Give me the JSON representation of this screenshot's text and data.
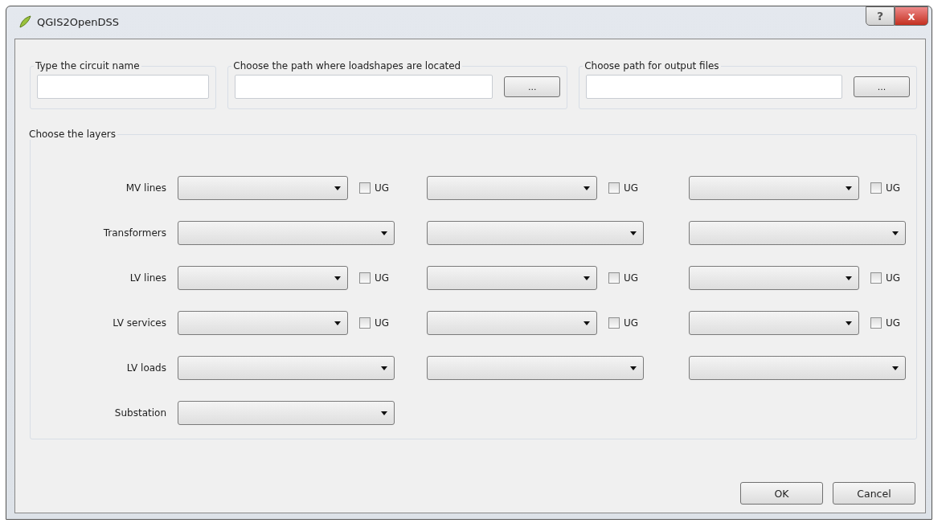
{
  "window": {
    "title": "QGIS2OpenDSS",
    "help_button": "?",
    "close_button": "x"
  },
  "path_groups": [
    {
      "title": "Type the circuit name"
    },
    {
      "title": "Choose the path where loadshapes are located",
      "browse": "..."
    },
    {
      "title": "Choose path for output files",
      "browse": "..."
    }
  ],
  "layers": {
    "title": "Choose the layers",
    "rows": [
      {
        "label": "MV lines",
        "cells": [
          {
            "kind": "combo_ug",
            "ug": "UG",
            "checked": false
          },
          {
            "kind": "combo_ug",
            "ug": "UG",
            "checked": false
          },
          {
            "kind": "combo_ug",
            "ug": "UG",
            "checked": false
          }
        ]
      },
      {
        "label": "Transformers",
        "cells": [
          {
            "kind": "combo"
          },
          {
            "kind": "combo"
          },
          {
            "kind": "combo"
          }
        ]
      },
      {
        "label": "LV lines",
        "cells": [
          {
            "kind": "combo_ug",
            "ug": "UG",
            "checked": false
          },
          {
            "kind": "combo_ug",
            "ug": "UG",
            "checked": false
          },
          {
            "kind": "combo_ug",
            "ug": "UG",
            "checked": false
          }
        ]
      },
      {
        "label": "LV services",
        "cells": [
          {
            "kind": "combo_ug",
            "ug": "UG",
            "checked": false
          },
          {
            "kind": "combo_ug",
            "ug": "UG",
            "checked": false
          },
          {
            "kind": "combo_ug",
            "ug": "UG",
            "checked": false
          }
        ]
      },
      {
        "label": "LV loads",
        "cells": [
          {
            "kind": "combo"
          },
          {
            "kind": "combo"
          },
          {
            "kind": "combo"
          }
        ]
      },
      {
        "label": "Substation",
        "cells": [
          {
            "kind": "combo"
          }
        ]
      }
    ]
  },
  "buttons": [
    "OK",
    "Cancel"
  ]
}
